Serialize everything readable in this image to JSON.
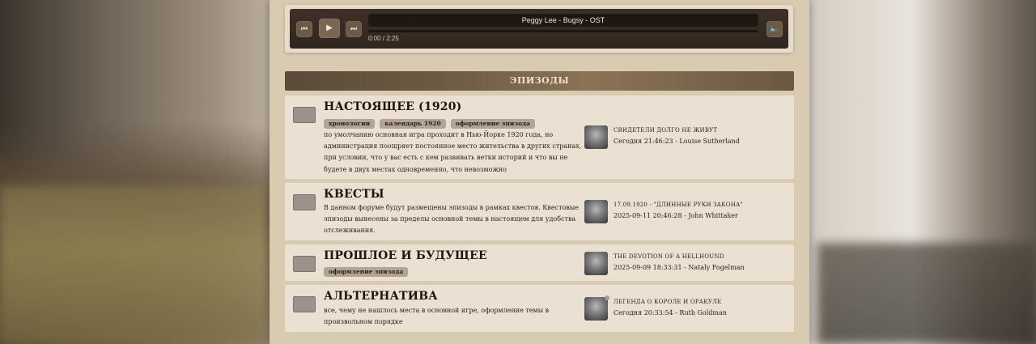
{
  "player": {
    "track": "Peggy Lee - Bugsy - OST",
    "time": "0:00 / 2:25",
    "icons": {
      "prev": "skip-back-icon",
      "play": "play-icon",
      "next": "skip-forward-icon",
      "volume": "volume-icon"
    }
  },
  "section": {
    "title": "ЭПИЗОДЫ"
  },
  "forums": [
    {
      "title": "НАСТОЯЩЕЕ (1920)",
      "tags": [
        "хронологии",
        "календарь 1920",
        "оформление эпизода"
      ],
      "description": "по умолчанию основная игра проходит в Нью-Йорке 1920 года, но администрация поощряет постоянное место жительства в других странах, при условии, что у вас есть с кем развивать ветки историй и что вы не будете в двух местах одновременно, что невозможно",
      "last_topic": "СВИДЕТЕЛИ ДОЛГО НЕ ЖИВУТ",
      "last_meta": "Сегодня 21:46:23 - Louise Sutherland"
    },
    {
      "title": "КВЕСТЫ",
      "tags": [],
      "description": "В данном форуме будут размещены эпизоды в рамках квестов. Квестовые эпизоды вынесены за пределы основной темы в настоящем для удобства отслеживания.",
      "last_topic": "17.09.1920 - \"ДЛИННЫЕ РУКИ ЗАКОНА\"",
      "last_meta": "2025-09-11 20:46:28 - John Whittaker"
    },
    {
      "title": "ПРОШЛОЕ И БУДУЩЕЕ",
      "tags": [
        "оформление эпизода"
      ],
      "description": "",
      "last_topic": "THE DEVOTION OF A HELLHOUND",
      "last_meta": "2025-09-09 18:33:31 - Nataly Fogelman"
    },
    {
      "title": "АЛЬТЕРНАТИВА",
      "tags": [],
      "description": "все, чему не нашлось места в основной игре, оформление темы в произвольном порядке",
      "last_topic": "ЛЕГЕНДА О КОРОЛЕ И ОРАКУЛЕ",
      "last_meta": "Сегодня 20:33:54 - Ruth Goldman"
    }
  ]
}
